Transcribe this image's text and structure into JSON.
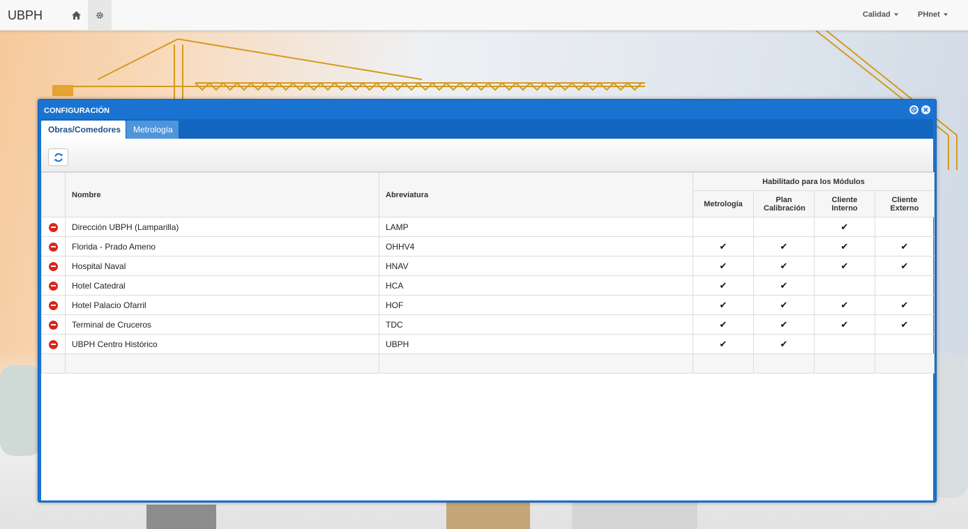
{
  "navbar": {
    "brand": "UBPH",
    "home_icon": "home-icon",
    "settings_icon": "gear-icon",
    "menus": [
      {
        "label": "Calidad"
      },
      {
        "label": "PHnet"
      }
    ]
  },
  "dialog": {
    "title": "CONFIGURACIÓN",
    "icons": [
      "minimize-icon",
      "close-icon"
    ],
    "tabs": [
      {
        "label": "Obras/Comedores",
        "active": true
      },
      {
        "label": "Metrología",
        "active": false
      }
    ],
    "toolbar": {
      "refresh_icon": "refresh-icon"
    },
    "table": {
      "headers": {
        "nombre": "Nombre",
        "abreviatura": "Abreviatura",
        "group": "Habilitado para los Módulos",
        "metrologia": "Metrología",
        "plan": "Plan Calibración",
        "cliente_interno": "Cliente Interno",
        "cliente_externo": "Cliente Externo"
      },
      "check_symbol": "✔",
      "rows": [
        {
          "nombre": "Dirección UBPH (Lamparilla)",
          "abreviatura": "LAMP",
          "metrologia": "",
          "plan": "",
          "cliente_interno": "✔",
          "cliente_externo": ""
        },
        {
          "nombre": "Florida - Prado Ameno",
          "abreviatura": "OHHV4",
          "metrologia": "✔",
          "plan": "✔",
          "cliente_interno": "✔",
          "cliente_externo": "✔"
        },
        {
          "nombre": "Hospital Naval",
          "abreviatura": "HNAV",
          "metrologia": "✔",
          "plan": "✔",
          "cliente_interno": "✔",
          "cliente_externo": "✔"
        },
        {
          "nombre": "Hotel Catedral",
          "abreviatura": "HCA",
          "metrologia": "✔",
          "plan": "✔",
          "cliente_interno": "",
          "cliente_externo": ""
        },
        {
          "nombre": "Hotel Palacio Ofarril",
          "abreviatura": "HOF",
          "metrologia": "✔",
          "plan": "✔",
          "cliente_interno": "✔",
          "cliente_externo": "✔"
        },
        {
          "nombre": "Terminal de Cruceros",
          "abreviatura": "TDC",
          "metrologia": "✔",
          "plan": "✔",
          "cliente_interno": "✔",
          "cliente_externo": "✔"
        },
        {
          "nombre": "UBPH Centro Histórico",
          "abreviatura": "UBPH",
          "metrologia": "✔",
          "plan": "✔",
          "cliente_interno": "",
          "cliente_externo": ""
        }
      ]
    }
  },
  "colors": {
    "dialog_blue": "#1a73d0",
    "tab_inactive": "#4e95dc",
    "delete_red": "#d9261c"
  }
}
